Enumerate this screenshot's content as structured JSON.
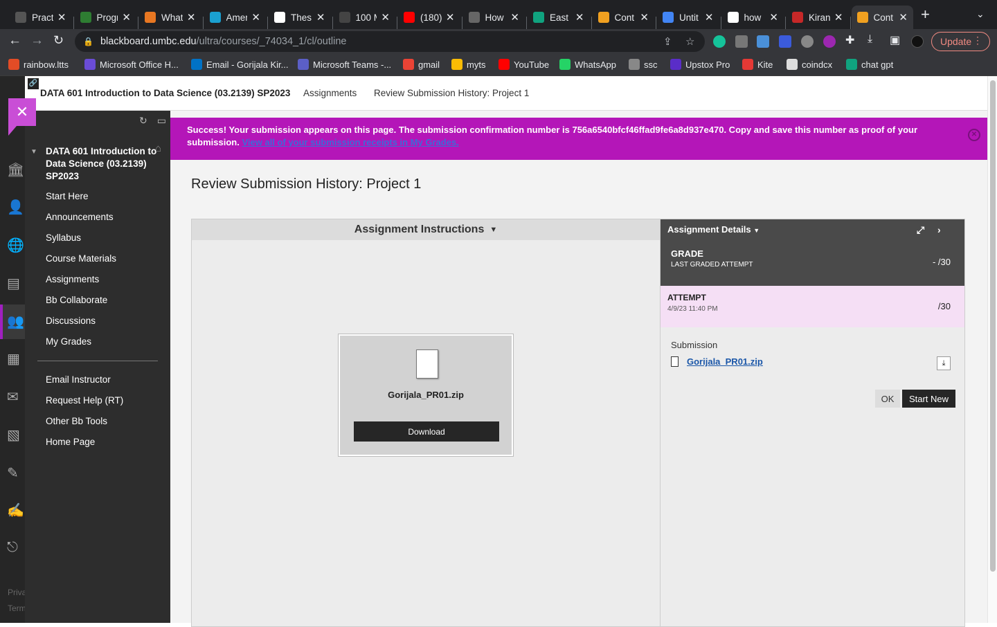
{
  "browser": {
    "tabs": [
      {
        "label": "Pract",
        "favicon": "cc",
        "color": "#555"
      },
      {
        "label": "Progr",
        "favicon": "leaf",
        "color": "#2e7d32"
      },
      {
        "label": "What",
        "favicon": "stack",
        "color": "#e87722"
      },
      {
        "label": "Amer",
        "favicon": "bird",
        "color": "#1aa0d0"
      },
      {
        "label": "Thes",
        "favicon": "m",
        "color": "#fff"
      },
      {
        "label": "100 M",
        "favicon": "co",
        "color": "#444"
      },
      {
        "label": "(180)",
        "favicon": "youtube",
        "color": "#ff0000"
      },
      {
        "label": "How",
        "favicon": "gear",
        "color": "#666"
      },
      {
        "label": "East",
        "favicon": "openai",
        "color": "#10a37f"
      },
      {
        "label": "Cont",
        "favicon": "pencil",
        "color": "#f0a020"
      },
      {
        "label": "Untit",
        "favicon": "docs",
        "color": "#4285f4"
      },
      {
        "label": "how",
        "favicon": "google",
        "color": "#fff"
      },
      {
        "label": "Kiran",
        "favicon": "shield",
        "color": "#c62828"
      },
      {
        "label": "Cont",
        "favicon": "pencil",
        "color": "#f0a020"
      }
    ],
    "url_domain": "blackboard.umbc.edu",
    "url_path": "/ultra/courses/_74034_1/cl/outline",
    "update_label": "Update",
    "bookmarks": [
      {
        "label": "rainbow.ltts",
        "color": "#e34c26"
      },
      {
        "label": "Microsoft Office H...",
        "color": "#6a4cd6"
      },
      {
        "label": "Email - Gorijala Kir...",
        "color": "#0072c6"
      },
      {
        "label": "Microsoft Teams -...",
        "color": "#5b5fc7"
      },
      {
        "label": "gmail",
        "color": "#ea4335"
      },
      {
        "label": "myts",
        "color": "#fbbc05"
      },
      {
        "label": "YouTube",
        "color": "#ff0000"
      },
      {
        "label": "WhatsApp",
        "color": "#25d366"
      },
      {
        "label": "ssc",
        "color": "#888"
      },
      {
        "label": "Upstox Pro",
        "color": "#5a2dc8"
      },
      {
        "label": "Kite",
        "color": "#e53935"
      },
      {
        "label": "coindcx",
        "color": "#ddd"
      },
      {
        "label": "chat gpt",
        "color": "#10a37f"
      }
    ]
  },
  "topbar": {
    "course": "DATA 601 Introduction to Data Science (03.2139) SP2023",
    "assignments": "Assignments",
    "current": "Review Submission History: Project 1"
  },
  "coursenav": {
    "course_title": "DATA 601 Introduction to Data Science (03.2139) SP2023",
    "items": [
      "Start Here",
      "Announcements",
      "Syllabus",
      "Course Materials",
      "Assignments",
      "Bb Collaborate",
      "Discussions",
      "My Grades"
    ],
    "items2": [
      "Email Instructor",
      "Request Help (RT)",
      "Other Bb Tools",
      "Home Page"
    ]
  },
  "rail_footer": [
    "Priva",
    "Term"
  ],
  "banner": {
    "text": "Success! Your submission appears on this page. The submission confirmation number is 756a6540bfcf46ffad9fe6a8d937e470. Copy and save this number as proof of your submission.",
    "link": "View all of your submission receipts in My Grades."
  },
  "page_title": "Review Submission History: Project 1",
  "instructions": {
    "header": "Assignment Instructions",
    "file_name": "Gorijala_PR01.zip",
    "download_label": "Download"
  },
  "details": {
    "header": "Assignment Details",
    "grade_label": "GRADE",
    "grade_sub": "LAST GRADED ATTEMPT",
    "grade_value": "- /30",
    "attempt_label": "ATTEMPT",
    "attempt_date": "4/9/23 11:40 PM",
    "attempt_value": "/30",
    "submission_label": "Submission",
    "submission_file": "Gorijala_PR01.zip",
    "ok_label": "OK",
    "start_new_label": "Start New"
  },
  "colors": {
    "accent": "#b416b8",
    "close_box": "#c94ed6",
    "attempt_bg": "#f5dff5"
  }
}
